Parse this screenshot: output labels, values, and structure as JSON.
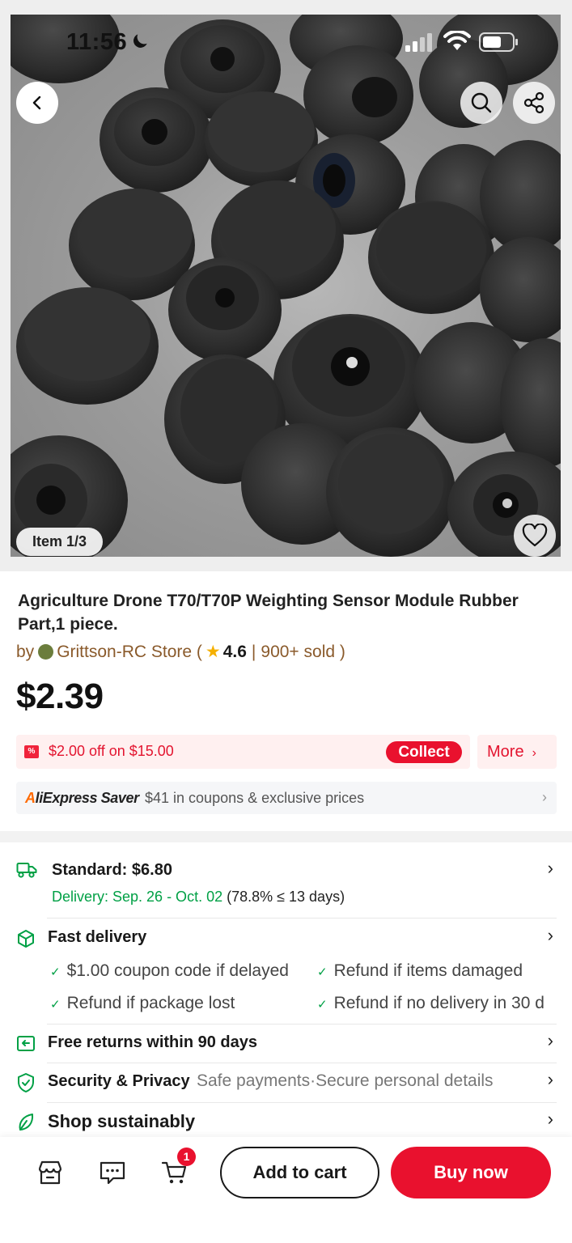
{
  "status_bar": {
    "time": "11:56"
  },
  "gallery": {
    "counter": "Item 1/3"
  },
  "product": {
    "title": "Agriculture Drone T70/T70P Weighting Sensor Module Rubber Part,1 piece.",
    "by": "by",
    "store_name": "Grittson-RC Store",
    "rating": "4.6",
    "sold": "900+ sold",
    "price": "$2.39"
  },
  "coupon": {
    "icon_text": "%",
    "text": "$2.00 off on $15.00",
    "collect_label": "Collect",
    "more_label": "More"
  },
  "saver": {
    "logo_a": "A",
    "logo_rest": "liExpress",
    "logo_saver": "Saver",
    "text": "$41 in coupons & exclusive prices"
  },
  "shipping": {
    "standard_label": "Standard: $6.80",
    "delivery_label": "Delivery: Sep. 26 - Oct. 02",
    "delivery_stat": "(78.8% ≤ 13 days)"
  },
  "fast_delivery": {
    "title": "Fast delivery",
    "benefits": [
      "$1.00 coupon code if delayed",
      "Refund if items damaged",
      "Refund if package lost",
      "Refund if no delivery in 30 d"
    ]
  },
  "returns": {
    "title": "Free returns within 90 days"
  },
  "security": {
    "title": "Security & Privacy",
    "detail": "Safe payments·Secure personal details"
  },
  "sustainable": {
    "title": "Shop sustainably"
  },
  "bottom_bar": {
    "cart_count": "1",
    "add_to_cart_label": "Add to cart",
    "buy_now_label": "Buy now"
  },
  "colors": {
    "accent_red": "#e9112e",
    "green": "#00a045",
    "store_brown": "#8a5a2b"
  },
  "icons": [
    "chevron-left-icon",
    "search-icon",
    "share-icon",
    "heart-icon",
    "truck-icon",
    "box-icon",
    "return-icon",
    "shield-icon",
    "leaf-icon",
    "store-icon",
    "chat-icon",
    "cart-icon"
  ]
}
